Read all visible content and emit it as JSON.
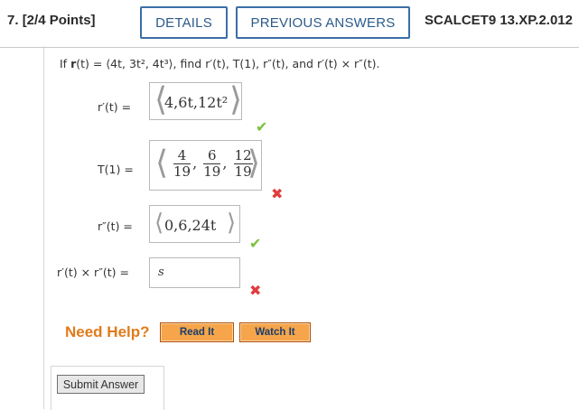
{
  "header": {
    "question_number": "7.",
    "points": "[2/4 Points]",
    "details_label": "DETAILS",
    "previous_answers_label": "PREVIOUS ANSWERS",
    "reference": "SCALCET9 13.XP.2.012"
  },
  "question": {
    "prompt_prefix": "If ",
    "prompt_r": "r",
    "prompt_mid": "(t) = ⟨4t, 3t², 4t³⟩, find ",
    "prompt_targets": "r′(t), T(1), r″(t), and r′(t) × r″(t).",
    "parts": [
      {
        "label": "r′(t)  =",
        "answer": "4,6t,12t²",
        "status": "correct"
      },
      {
        "label": "T(1)  =",
        "answer_fractions": [
          {
            "num": "4",
            "den": "19"
          },
          {
            "num": "6",
            "den": "19"
          },
          {
            "num": "12",
            "den": "19"
          }
        ],
        "status": "incorrect"
      },
      {
        "label": "r″(t)  =",
        "answer": "0,6,24t",
        "status": "correct"
      },
      {
        "label": "r′(t) × r″(t)  =",
        "answer": "s",
        "status": "incorrect"
      }
    ]
  },
  "help": {
    "label": "Need Help?",
    "read_it": "Read It",
    "watch_it": "Watch It"
  },
  "submit_label": "Submit Answer",
  "colors": {
    "correct": "#7cc03b",
    "incorrect": "#e33b3b",
    "help": "#e07b1a",
    "button_border": "#3a6ea5"
  }
}
